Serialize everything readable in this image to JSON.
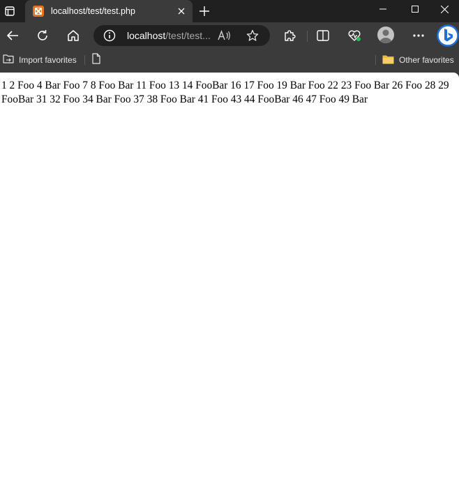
{
  "browser": {
    "tab": {
      "title": "localhost/test/test.php"
    },
    "address_bar": {
      "host": "localhost",
      "path": "/test/test..."
    },
    "favorites_bar": {
      "import_label": "Import favorites",
      "other_label": "Other favorites"
    },
    "icons": {
      "tab_actions": "tab-actions-icon",
      "favicon": "xampp-favicon",
      "close": "close-icon",
      "new_tab": "plus-icon",
      "back": "back-arrow-icon",
      "refresh": "refresh-icon",
      "home": "home-icon",
      "site_info": "info-icon",
      "read_aloud": "read-aloud-icon",
      "favorite": "star-icon",
      "extensions": "puzzle-icon",
      "split_screen": "split-screen-icon",
      "browser_essentials": "heart-pulse-icon",
      "profile": "avatar",
      "settings": "more-icon",
      "copilot": "bing-icon"
    },
    "colors": {
      "titlebar": "#202020",
      "toolbar": "#3b3b3b",
      "favicon": "#e8711f",
      "copilot_ring": "#1f6fd6",
      "status_dot": "#2dba5a"
    }
  },
  "page": {
    "body_text": "1 2 Foo 4 Bar Foo 7 8 Foo Bar 11 Foo 13 14 FooBar 16 17 Foo 19 Bar Foo 22 23 Foo Bar 26 Foo 28 29 FooBar 31 32 Foo 34 Bar Foo 37 38 Foo Bar 41 Foo 43 44 FooBar 46 47 Foo 49 Bar"
  }
}
